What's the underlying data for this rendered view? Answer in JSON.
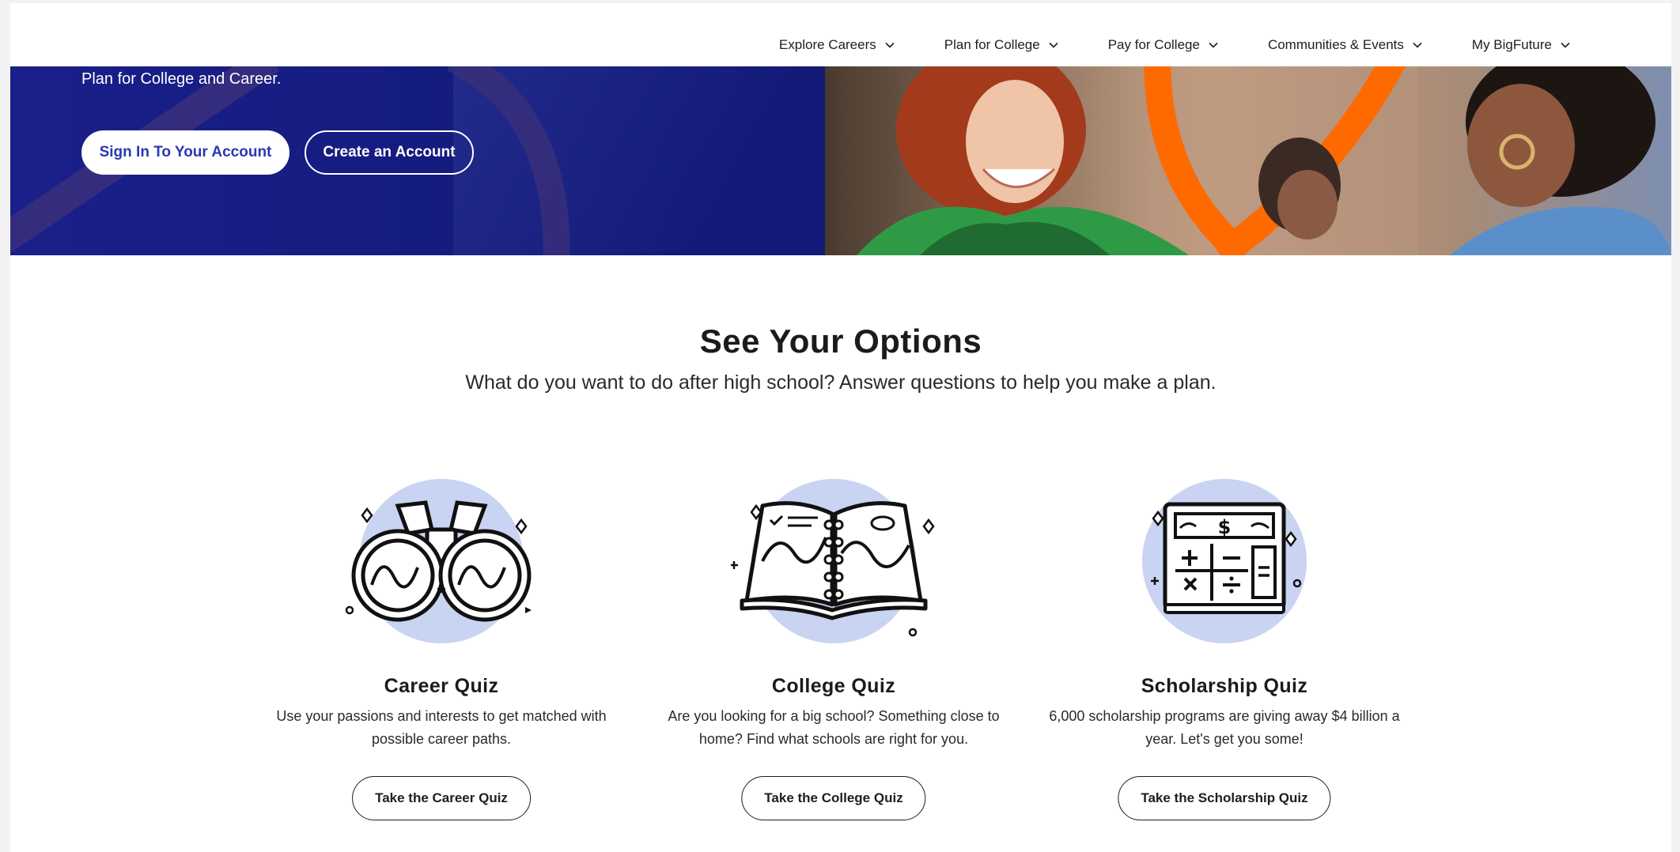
{
  "nav": {
    "items": [
      {
        "label": "Explore Careers"
      },
      {
        "label": "Plan for College"
      },
      {
        "label": "Pay for College"
      },
      {
        "label": "Communities & Events"
      },
      {
        "label": "My BigFuture"
      }
    ],
    "chevron_icon": "chevron-down-icon"
  },
  "hero": {
    "text": "Plan for College and Career.",
    "sign_in_label": "Sign In To Your Account",
    "create_account_label": "Create an Account",
    "colors": {
      "navy": "#141b7d",
      "accent_orange": "#ff6a00",
      "button_text": "#2a38b4"
    }
  },
  "options": {
    "title": "See Your Options",
    "subtitle": "What do you want to do after high school? Answer questions to help you make a plan.",
    "cards": [
      {
        "icon": "binoculars-icon",
        "title": "Career Quiz",
        "description": "Use your passions and interests to get matched with possible career paths.",
        "button_label": "Take the Career Quiz"
      },
      {
        "icon": "map-book-icon",
        "title": "College Quiz",
        "description": "Are you looking for a big school? Something close to home? Find what schools are right for you.",
        "button_label": "Take the College Quiz"
      },
      {
        "icon": "calculator-icon",
        "title": "Scholarship Quiz",
        "description": "6,000 scholarship programs are giving away $4 billion a year. Let's get you some!",
        "button_label": "Take the Scholarship Quiz"
      }
    ],
    "illustration_circle_color": "#c9d3f2"
  }
}
